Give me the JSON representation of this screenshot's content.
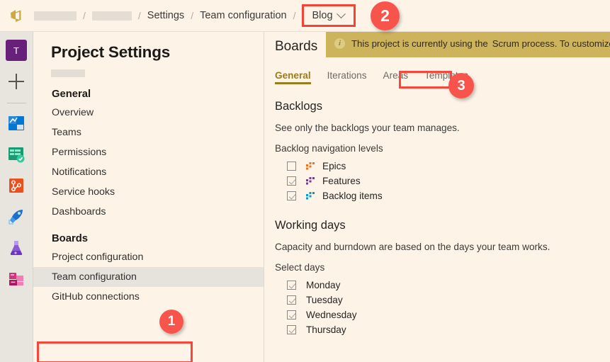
{
  "topbar": {
    "logo_icon": "azure-devops-logo-icon",
    "breadcrumbs": [
      {
        "type": "redacted",
        "label": ""
      },
      {
        "type": "redacted",
        "label": ""
      },
      {
        "type": "text",
        "label": "Settings"
      },
      {
        "type": "text",
        "label": "Team configuration"
      }
    ],
    "separator": "/",
    "blog_dropdown": {
      "label": "Blog",
      "chevron_icon": "chevron-down-icon"
    }
  },
  "callouts": [
    {
      "number": "1"
    },
    {
      "number": "2"
    },
    {
      "number": "3"
    }
  ],
  "rail": {
    "avatar_initial": "T",
    "add_icon": "plus-icon",
    "items": [
      {
        "icon": "overview-dashboard-icon"
      },
      {
        "icon": "boards-check-icon"
      },
      {
        "icon": "repos-branch-icon"
      },
      {
        "icon": "pipelines-rocket-icon"
      },
      {
        "icon": "test-plans-flask-icon"
      },
      {
        "icon": "artifacts-boxes-icon"
      }
    ]
  },
  "settings_nav": {
    "title": "Project Settings",
    "project_name_redacted": "",
    "groups": [
      {
        "heading": "General",
        "items": [
          {
            "label": "Overview",
            "selected": false
          },
          {
            "label": "Teams",
            "selected": false
          },
          {
            "label": "Permissions",
            "selected": false
          },
          {
            "label": "Notifications",
            "selected": false
          },
          {
            "label": "Service hooks",
            "selected": false
          },
          {
            "label": "Dashboards",
            "selected": false
          }
        ]
      },
      {
        "heading": "Boards",
        "items": [
          {
            "label": "Project configuration",
            "selected": false
          },
          {
            "label": "Team configuration",
            "selected": true
          },
          {
            "label": "GitHub connections",
            "selected": false
          }
        ]
      }
    ]
  },
  "main": {
    "title": "Boards",
    "banner": {
      "info_icon": "info-icon",
      "text_before": "This project is currently using the",
      "redacted": "",
      "text_after": "Scrum process. To customize",
      "background_color": "#cdb35c"
    },
    "tabs": [
      {
        "label": "General",
        "active": true
      },
      {
        "label": "Iterations",
        "active": false
      },
      {
        "label": "Areas",
        "active": false
      },
      {
        "label": "Templates",
        "active": false
      }
    ],
    "sections": [
      {
        "title": "Backlogs",
        "description": "See only the backlogs your team manages.",
        "field_label": "Backlog navigation levels",
        "options": [
          {
            "label": "Epics",
            "checked": false,
            "icon": "epics-level-icon",
            "color": "#f2711c"
          },
          {
            "label": "Features",
            "checked": true,
            "icon": "features-level-icon",
            "color": "#773b93"
          },
          {
            "label": "Backlog items",
            "checked": true,
            "icon": "backlog-items-level-icon",
            "color": "#009ccc"
          }
        ]
      },
      {
        "title": "Working days",
        "description": "Capacity and burndown are based on the days your team works.",
        "field_label": "Select days",
        "options": [
          {
            "label": "Monday",
            "checked": true
          },
          {
            "label": "Tuesday",
            "checked": true
          },
          {
            "label": "Wednesday",
            "checked": true
          },
          {
            "label": "Thursday",
            "checked": true
          }
        ]
      }
    ]
  },
  "colors": {
    "page_bg": "#fdf3e7",
    "rail_bg": "#e8e4de",
    "callout_red": "#f9544b",
    "highlight_red": "#f9453a",
    "banner_gold": "#cdb35c",
    "tab_active": "#9a7c1c",
    "avatar_purple": "#68217a"
  }
}
